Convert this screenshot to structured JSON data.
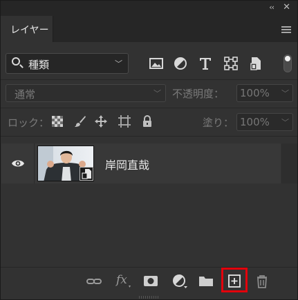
{
  "window": {
    "collapse_glyph": "‹‹",
    "close_glyph": "✕"
  },
  "tabs": [
    {
      "label": "レイヤー",
      "active": true
    }
  ],
  "filter": {
    "kind_value": "種類",
    "icons": [
      "image-filter-icon",
      "adjustment-filter-icon",
      "type-filter-icon",
      "shape-filter-icon",
      "smart-object-filter-icon"
    ],
    "toggle_on": true
  },
  "blend": {
    "mode_value": "通常",
    "opacity_label": "不透明度：",
    "opacity_value": "100%"
  },
  "lock": {
    "label": "ロック：",
    "fill_label": "塗り：",
    "fill_value": "100%"
  },
  "layers": [
    {
      "name": "岸岡直哉",
      "visible": true,
      "type": "smart-object"
    }
  ],
  "bottom_toolbar": {
    "fx_label": "fx",
    "highlighted": "new-layer-button",
    "highlight_color": "#e3000b"
  },
  "colors": {
    "panel_bg": "#323232",
    "selected_row": "#383838",
    "text": "#e8e8e8",
    "dim_text": "#7a7a7a"
  }
}
